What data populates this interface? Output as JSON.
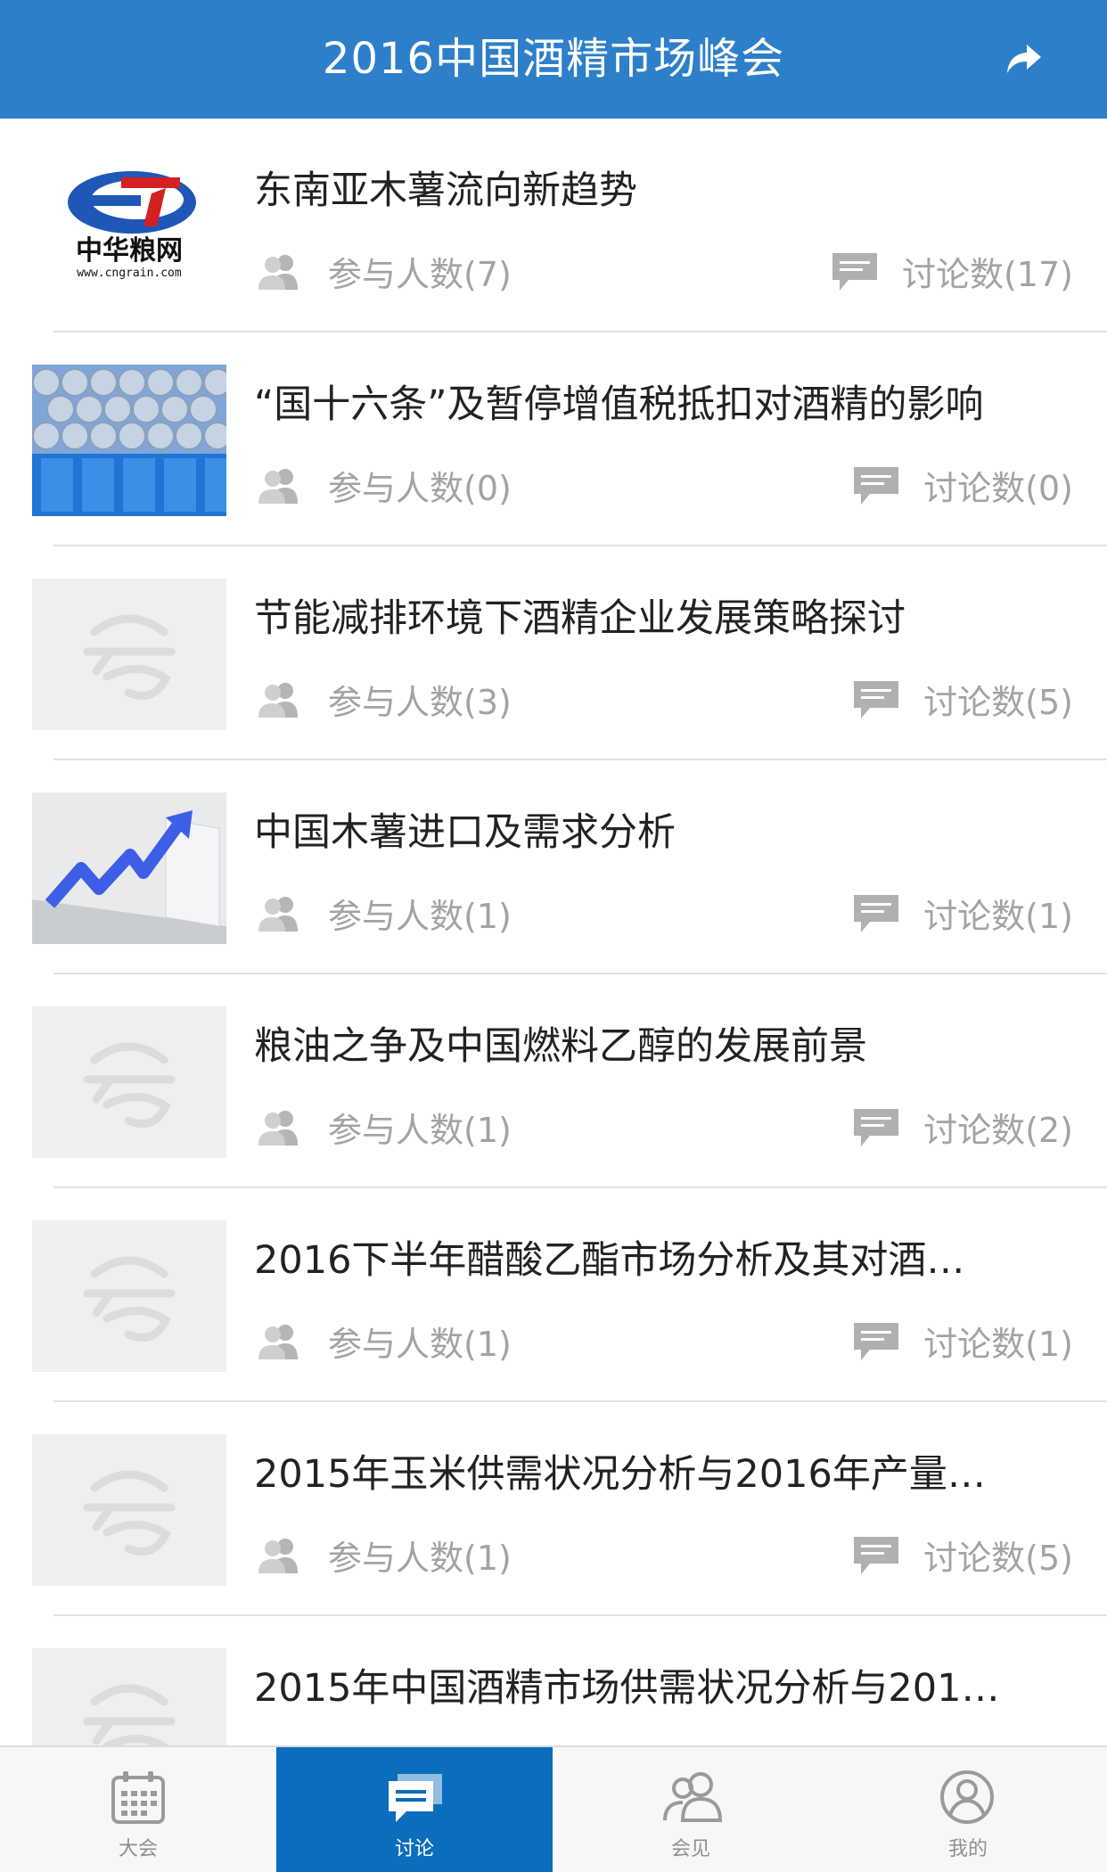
{
  "header": {
    "title": "2016中国酒精市场峰会",
    "share_icon": "share-icon"
  },
  "topics": [
    {
      "title": "东南亚木薯流向新趋势",
      "participants": "参与人数(7)",
      "discussions": "讨论数(17)",
      "thumb": "cngrain-logo",
      "logo_text": "中华粮网",
      "logo_url": "www.cngrain.com"
    },
    {
      "title": "“国十六条”及暂停增值税抵扣对酒精的影响",
      "participants": "参与人数(0)",
      "discussions": "讨论数(0)",
      "thumb": "blue-barrels-photo"
    },
    {
      "title": "节能减排环境下酒精企业发展策略探讨",
      "participants": "参与人数(3)",
      "discussions": "讨论数(5)",
      "thumb": "placeholder"
    },
    {
      "title": "中国木薯进口及需求分析",
      "participants": "参与人数(1)",
      "discussions": "讨论数(1)",
      "thumb": "growth-arrow-photo"
    },
    {
      "title": "粮油之争及中国燃料乙醇的发展前景",
      "participants": "参与人数(1)",
      "discussions": "讨论数(2)",
      "thumb": "placeholder"
    },
    {
      "title": "2016下半年醋酸乙酯市场分析及其对酒…",
      "participants": "参与人数(1)",
      "discussions": "讨论数(1)",
      "thumb": "placeholder"
    },
    {
      "title": "2015年玉米供需状况分析与2016年产量…",
      "participants": "参与人数(1)",
      "discussions": "讨论数(5)",
      "thumb": "placeholder"
    },
    {
      "title": "2015年中国酒精市场供需状况分析与201…",
      "participants": "",
      "discussions": "",
      "thumb": "placeholder"
    }
  ],
  "tabs": [
    {
      "label": "大会",
      "icon": "calendar-icon",
      "active": false
    },
    {
      "label": "讨论",
      "icon": "chat-icon",
      "active": true
    },
    {
      "label": "会见",
      "icon": "people-icon",
      "active": false
    },
    {
      "label": "我的",
      "icon": "profile-icon",
      "active": false
    }
  ],
  "colors": {
    "header": "#2d7fc9",
    "active_tab": "#0b6dbd",
    "meta_text": "#a3a3a3"
  }
}
